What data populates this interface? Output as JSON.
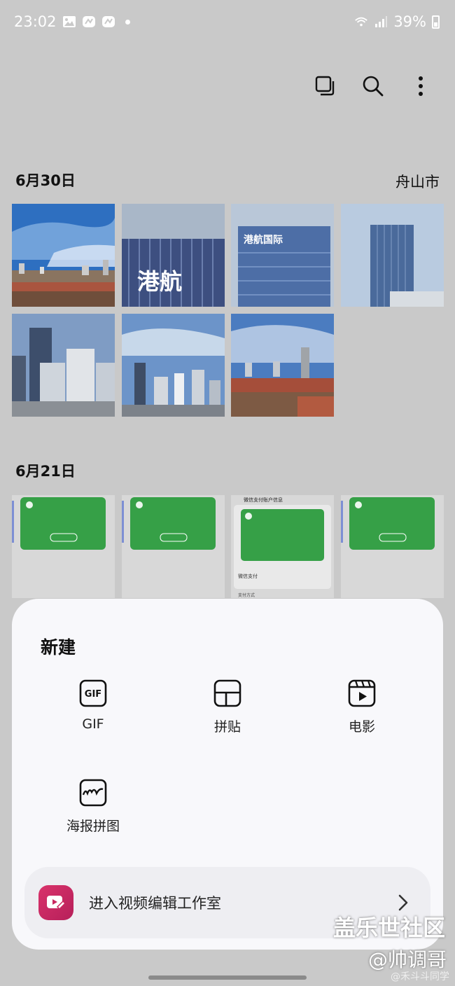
{
  "status": {
    "time": "23:02",
    "battery": "39%"
  },
  "icons": {
    "select": "select-multiple-icon",
    "search": "search-icon",
    "more": "more-vert-icon"
  },
  "sections": [
    {
      "date": "6月30日",
      "location": "舟山市"
    },
    {
      "date": "6月21日"
    }
  ],
  "sheet": {
    "title": "新建",
    "options": [
      {
        "label": "GIF",
        "icon_text": "GIF"
      },
      {
        "label": "拼贴"
      },
      {
        "label": "电影"
      },
      {
        "label": "海报拼图"
      }
    ],
    "studio_label": "进入视频编辑工作室"
  },
  "thumb_texts": {
    "sign": "港航国际",
    "sign_short": "港航",
    "wechat_title": "微信支付账户信息",
    "wechat_pay": "微信支付",
    "wechat_method": "支付方式"
  },
  "watermark": {
    "line1": "盖乐世社区",
    "line2": "@帅调哥",
    "line3": "@禾斗斗同学"
  },
  "colors": {
    "accent": "#d9336b",
    "wechat_green": "#3ab24a"
  }
}
